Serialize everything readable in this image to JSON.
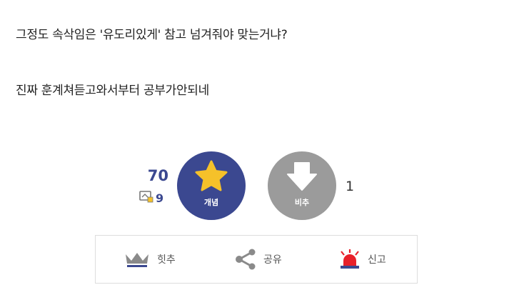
{
  "post": {
    "line1": "그정도 속삭임은 '유도리있게' 참고 넘겨줘야 맞는거냐?",
    "line2": "진짜 훈계쳐듣고와서부터 공부가안되네"
  },
  "votes": {
    "recommend_count": "70",
    "comment_count": "9",
    "up_label": "개념",
    "down_label": "비추",
    "down_count": "1"
  },
  "actions": {
    "hit_label": "힛추",
    "share_label": "공유",
    "report_label": "신고"
  },
  "colors": {
    "up_button": "#3b4890",
    "down_button": "#9b9b9b",
    "star": "#f5c12a",
    "report": "#e8202a",
    "count_text": "#3b4890"
  }
}
